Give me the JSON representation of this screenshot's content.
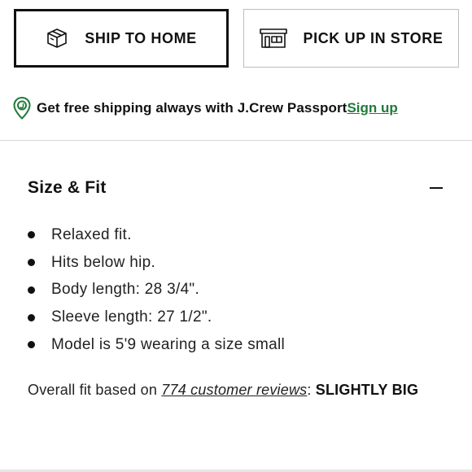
{
  "delivery": {
    "ship_to_home": {
      "label": "SHIP TO HOME",
      "icon": "package-box-icon",
      "selected": true
    },
    "pick_up_in_store": {
      "label": "PICK UP IN STORE",
      "icon": "storefront-icon",
      "selected": false
    }
  },
  "passport": {
    "text": "Get free shipping always with J.Crew Passport",
    "signup_label": "Sign up",
    "icon": "location-pin-icon",
    "accent_color": "#1f7a3a"
  },
  "size_fit": {
    "title": "Size & Fit",
    "toggle_icon": "minus-icon",
    "items": [
      "Relaxed fit.",
      "Hits below hip.",
      "Body length: 28 3/4\".",
      "Sleeve length: 27 1/2\".",
      "Model is 5'9 wearing a size small"
    ],
    "overall_prefix": "Overall fit based on ",
    "reviews_link": "774 customer reviews",
    "overall_separator": ": ",
    "overall_value": "SLIGHTLY BIG"
  }
}
